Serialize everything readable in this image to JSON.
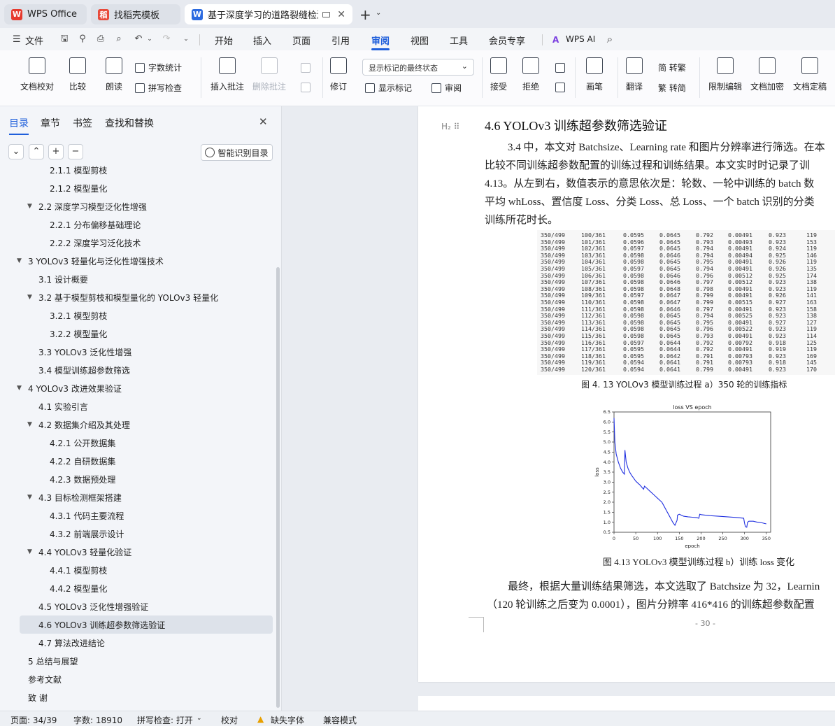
{
  "tabs": [
    {
      "label": "WPS Office",
      "logo": "W"
    },
    {
      "label": "找稻壳模板",
      "logo": "稻"
    },
    {
      "label": "基于深度学习的道路裂缝检测",
      "logo": "W"
    }
  ],
  "menu": {
    "file": "文件",
    "items": [
      "开始",
      "插入",
      "页面",
      "引用",
      "审阅",
      "视图",
      "工具",
      "会员专享"
    ],
    "active": "审阅",
    "wps_ai": "WPS AI"
  },
  "ribbon": {
    "doc_check": "文档校对",
    "compare": "比较",
    "read": "朗读",
    "word_count": "字数统计",
    "spell_check": "拼写检查",
    "insert_comment": "插入批注",
    "delete_comment": "删除批注",
    "revise": "修订",
    "show_state": "显示标记的最终状态",
    "show_marks": "显示标记",
    "review": "审阅",
    "accept": "接受",
    "reject": "拒绝",
    "pen": "画笔",
    "translate": "翻译",
    "to_trad": "简 转繁",
    "to_simp": "繁 转简",
    "restrict_edit": "限制编辑",
    "encrypt": "文档加密",
    "finalize": "文档定稿"
  },
  "panel": {
    "tabs": [
      "目录",
      "章节",
      "书签",
      "查找和替换"
    ],
    "smart_label": "智能识别目录"
  },
  "toc": [
    {
      "text": "2.1.1 模型剪枝",
      "lvl": 3
    },
    {
      "text": "2.1.2 模型量化",
      "lvl": 3
    },
    {
      "text": "2.2 深度学习模型泛化性增强",
      "lvl": 2,
      "exp": true
    },
    {
      "text": "2.2.1 分布偏移基础理论",
      "lvl": 3
    },
    {
      "text": "2.2.2 深度学习泛化技术",
      "lvl": 3
    },
    {
      "text": "3 YOLOv3 轻量化与泛化性增强技术",
      "lvl": 1,
      "exp": true
    },
    {
      "text": "3.1 设计概要",
      "lvl": 2
    },
    {
      "text": "3.2 基于模型剪枝和模型量化的 YOLOv3 轻量化",
      "lvl": 2,
      "exp": true
    },
    {
      "text": "3.2.1 模型剪枝",
      "lvl": 3
    },
    {
      "text": "3.2.2 模型量化",
      "lvl": 3
    },
    {
      "text": "3.3 YOLOv3 泛化性增强",
      "lvl": 2
    },
    {
      "text": "3.4 模型训练超参数筛选",
      "lvl": 2
    },
    {
      "text": "4 YOLOv3 改进效果验证",
      "lvl": 1,
      "exp": true
    },
    {
      "text": "4.1 实验引言",
      "lvl": 2
    },
    {
      "text": "4.2 数据集介绍及其处理",
      "lvl": 2,
      "exp": true
    },
    {
      "text": "4.2.1 公开数据集",
      "lvl": 3
    },
    {
      "text": "4.2.2 自研数据集",
      "lvl": 3
    },
    {
      "text": "4.2.3 数据预处理",
      "lvl": 3
    },
    {
      "text": "4.3 目标检测框架搭建",
      "lvl": 2,
      "exp": true
    },
    {
      "text": "4.3.1 代码主要流程",
      "lvl": 3
    },
    {
      "text": "4.3.2 前端展示设计",
      "lvl": 3
    },
    {
      "text": "4.4 YOLOv3 轻量化验证",
      "lvl": 2,
      "exp": true
    },
    {
      "text": "4.4.1 模型剪枝",
      "lvl": 3
    },
    {
      "text": "4.4.2 模型量化",
      "lvl": 3
    },
    {
      "text": "4.5 YOLOv3 泛化性增强验证",
      "lvl": 2
    },
    {
      "text": "4.6 YOLOv3 训练超参数筛选验证",
      "lvl": 2,
      "sel": true
    },
    {
      "text": "4.7 算法改进结论",
      "lvl": 2
    },
    {
      "text": "5 总结与展望",
      "lvl": 1
    },
    {
      "text": "参考文献",
      "lvl": 1
    },
    {
      "text": "致 谢",
      "lvl": 1
    }
  ],
  "doc": {
    "heading": "4.6 YOLOv3 训练超参数筛选验证",
    "para1": [
      "3.4 中，本文对 Batchsize、Learning rate 和图片分辨率进行筛选。在本",
      "比较不同训练超参数配置的训练过程和训练结果。本文实时时记录了训",
      "4.13。从左到右，数值表示的意思依次是：轮数、一轮中训练的 batch 数",
      "平均 whLoss、置信度 Loss、分类 Loss、总 Loss、一个 batch 识别的分类",
      "训练所花时长。"
    ],
    "log_rows": [
      [
        "350/499",
        "100/361",
        "0.0595",
        "0.0645",
        "0.792",
        "0.00491",
        "0.923",
        "119"
      ],
      [
        "350/499",
        "101/361",
        "0.0596",
        "0.0645",
        "0.793",
        "0.00493",
        "0.923",
        "153"
      ],
      [
        "350/499",
        "102/361",
        "0.0597",
        "0.0645",
        "0.794",
        "0.00491",
        "0.924",
        "119"
      ],
      [
        "350/499",
        "103/361",
        "0.0598",
        "0.0646",
        "0.794",
        "0.00494",
        "0.925",
        "146"
      ],
      [
        "350/499",
        "104/361",
        "0.0598",
        "0.0645",
        "0.795",
        "0.00491",
        "0.926",
        "119"
      ],
      [
        "350/499",
        "105/361",
        "0.0597",
        "0.0645",
        "0.794",
        "0.00491",
        "0.926",
        "135"
      ],
      [
        "350/499",
        "106/361",
        "0.0598",
        "0.0646",
        "0.796",
        "0.00512",
        "0.925",
        "174"
      ],
      [
        "350/499",
        "107/361",
        "0.0598",
        "0.0646",
        "0.797",
        "0.00512",
        "0.923",
        "138"
      ],
      [
        "350/499",
        "108/361",
        "0.0598",
        "0.0648",
        "0.798",
        "0.00491",
        "0.923",
        "119"
      ],
      [
        "350/499",
        "109/361",
        "0.0597",
        "0.0647",
        "0.799",
        "0.00491",
        "0.926",
        "141"
      ],
      [
        "350/499",
        "110/361",
        "0.0598",
        "0.0647",
        "0.799",
        "0.00515",
        "0.927",
        "163"
      ],
      [
        "350/499",
        "111/361",
        "0.0598",
        "0.0646",
        "0.797",
        "0.00491",
        "0.923",
        "158"
      ],
      [
        "350/499",
        "112/361",
        "0.0598",
        "0.0645",
        "0.794",
        "0.00525",
        "0.923",
        "138"
      ],
      [
        "350/499",
        "113/361",
        "0.0598",
        "0.0645",
        "0.795",
        "0.00491",
        "0.927",
        "127"
      ],
      [
        "350/499",
        "114/361",
        "0.0598",
        "0.0645",
        "0.796",
        "0.00522",
        "0.923",
        "119"
      ],
      [
        "350/499",
        "115/361",
        "0.0598",
        "0.0645",
        "0.793",
        "0.00491",
        "0.923",
        "114"
      ],
      [
        "350/499",
        "116/361",
        "0.0597",
        "0.0644",
        "0.792",
        "0.00792",
        "0.918",
        "125"
      ],
      [
        "350/499",
        "117/361",
        "0.0595",
        "0.0644",
        "0.792",
        "0.00491",
        "0.919",
        "119"
      ],
      [
        "350/499",
        "118/361",
        "0.0595",
        "0.0642",
        "0.791",
        "0.00793",
        "0.923",
        "169"
      ],
      [
        "350/499",
        "119/361",
        "0.0594",
        "0.0641",
        "0.791",
        "0.00793",
        "0.918",
        "145"
      ],
      [
        "350/499",
        "120/361",
        "0.0594",
        "0.0641",
        "0.799",
        "0.00491",
        "0.923",
        "170"
      ]
    ],
    "caption1": "图 4. 13 YOLOv3 模型训练过程 a）350 轮的训练指标",
    "caption2": "图 4.13 YOLOv3 模型训练过程 b）训练 loss 变化",
    "para2": [
      "最终，根据大量训练结果筛选，本文选取了 Batchsize 为 32，Learnin",
      "（120 轮训练之后变为 0.0001），图片分辨率 416*416 的训练超参数配置"
    ],
    "page_num": "- 30 -"
  },
  "chart_data": {
    "type": "line",
    "title": "loss VS epoch",
    "xlabel": "epoch",
    "ylabel": "loss",
    "xlim": [
      0,
      360
    ],
    "ylim": [
      0.5,
      6.5
    ],
    "xticks": [
      0,
      50,
      100,
      150,
      200,
      250,
      300,
      350
    ],
    "yticks": [
      0.5,
      1.0,
      1.5,
      2.0,
      2.5,
      3.0,
      3.5,
      4.0,
      4.5,
      5.0,
      5.5,
      6.0,
      6.5
    ],
    "color": "#2030e0",
    "x": [
      0,
      2,
      5,
      10,
      15,
      20,
      24,
      25,
      28,
      32,
      36,
      40,
      45,
      50,
      55,
      60,
      65,
      68,
      70,
      75,
      80,
      85,
      90,
      95,
      100,
      105,
      110,
      115,
      120,
      125,
      130,
      135,
      140,
      145,
      146,
      150,
      155,
      160,
      170,
      180,
      190,
      195,
      197,
      200,
      210,
      220,
      240,
      260,
      280,
      298,
      300,
      302,
      305,
      307,
      310,
      320,
      330,
      340,
      350
    ],
    "y": [
      6.2,
      5.0,
      4.4,
      4.0,
      3.7,
      3.5,
      3.4,
      4.6,
      4.0,
      3.7,
      3.5,
      3.35,
      3.2,
      3.05,
      2.95,
      2.85,
      2.72,
      2.65,
      2.8,
      2.7,
      2.6,
      2.5,
      2.4,
      2.3,
      2.2,
      2.1,
      2.0,
      1.8,
      1.6,
      1.4,
      1.2,
      1.0,
      0.85,
      1.1,
      1.35,
      1.4,
      1.35,
      1.3,
      1.27,
      1.25,
      1.23,
      1.2,
      1.4,
      1.38,
      1.35,
      1.33,
      1.3,
      1.27,
      1.24,
      1.2,
      0.95,
      0.78,
      0.75,
      1.0,
      1.05,
      1.05,
      1.0,
      0.97,
      0.92
    ]
  },
  "status": {
    "page": "页面: 34/39",
    "words": "字数: 18910",
    "spell": "拼写检查: 打开",
    "proof": "校对",
    "missing_font": "缺失字体",
    "compat": "兼容模式"
  }
}
